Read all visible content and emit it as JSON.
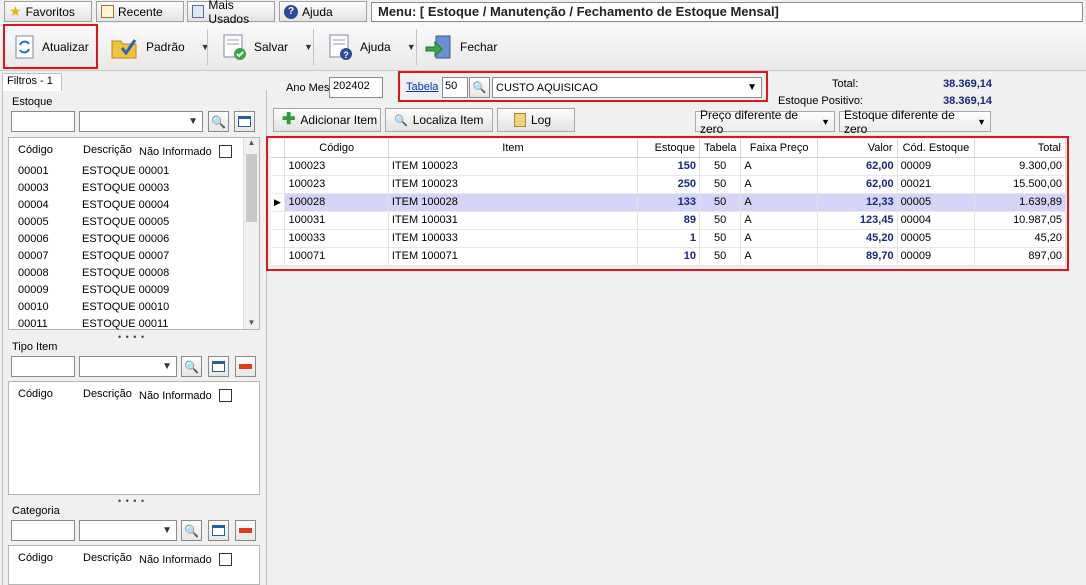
{
  "topbar": {
    "favoritos": "Favoritos",
    "recente": "Recente",
    "mais_usados": "Mais Usados",
    "ajuda": "Ajuda",
    "menu_path": "Menu: [ Estoque / Manutenção / Fechamento de Estoque Mensal]"
  },
  "toolbar": {
    "atualizar": "Atualizar",
    "padrao": "Padrão",
    "salvar": "Salvar",
    "ajuda": "Ajuda",
    "fechar": "Fechar"
  },
  "filters": {
    "tab": "Filtros - 1",
    "estoque": {
      "title": "Estoque",
      "col_codigo": "Código",
      "col_descricao": "Descrição",
      "nao_informado": "Não Informado",
      "items": [
        {
          "codigo": "00001",
          "descricao": "ESTOQUE 00001"
        },
        {
          "codigo": "00003",
          "descricao": "ESTOQUE 00003"
        },
        {
          "codigo": "00004",
          "descricao": "ESTOQUE 00004"
        },
        {
          "codigo": "00005",
          "descricao": "ESTOQUE 00005"
        },
        {
          "codigo": "00006",
          "descricao": "ESTOQUE 00006"
        },
        {
          "codigo": "00007",
          "descricao": "ESTOQUE 00007"
        },
        {
          "codigo": "00008",
          "descricao": "ESTOQUE 00008"
        },
        {
          "codigo": "00009",
          "descricao": "ESTOQUE 00009"
        },
        {
          "codigo": "00010",
          "descricao": "ESTOQUE 00010"
        },
        {
          "codigo": "00011",
          "descricao": "ESTOQUE 00011"
        }
      ]
    },
    "tipo_item": {
      "title": "Tipo Item",
      "col_codigo": "Código",
      "col_descricao": "Descrição",
      "nao_informado": "Não Informado"
    },
    "categoria": {
      "title": "Categoria",
      "col_codigo": "Código",
      "col_descricao": "Descrição",
      "nao_informado": "Não Informado"
    }
  },
  "header": {
    "ano_mes_label": "Ano Mes",
    "ano_mes_value": "202402",
    "tabela_link": "Tabela",
    "tabela_code": "50",
    "tabela_name": "CUSTO AQUISICAO",
    "total_label": "Total:",
    "total_value": "38.369,14",
    "estoque_positivo_label": "Estoque Positivo:",
    "estoque_positivo_value": "38.369,14"
  },
  "actions": {
    "adicionar": "Adicionar Item",
    "localiza": "Localiza Item",
    "log": "Log",
    "preco_filter": "Preço diferente de zero",
    "estoque_filter": "Estoque diferente de zero"
  },
  "grid": {
    "columns": [
      "Código",
      "Item",
      "Estoque",
      "Tabela",
      "Faixa Preço",
      "Valor",
      "Cód. Estoque",
      "Total"
    ],
    "rows": [
      {
        "codigo": "100023",
        "item": "ITEM 100023",
        "estoque": "150",
        "tabela": "50",
        "faixa": "A",
        "valor": "62,00",
        "cod_estoque": "00009",
        "total": "9.300,00"
      },
      {
        "codigo": "100023",
        "item": "ITEM 100023",
        "estoque": "250",
        "tabela": "50",
        "faixa": "A",
        "valor": "62,00",
        "cod_estoque": "00021",
        "total": "15.500,00"
      },
      {
        "codigo": "100028",
        "item": "ITEM 100028",
        "estoque": "133",
        "tabela": "50",
        "faixa": "A",
        "valor": "12,33",
        "cod_estoque": "00005",
        "total": "1.639,89"
      },
      {
        "codigo": "100031",
        "item": "ITEM 100031",
        "estoque": "89",
        "tabela": "50",
        "faixa": "A",
        "valor": "123,45",
        "cod_estoque": "00004",
        "total": "10.987,05"
      },
      {
        "codigo": "100033",
        "item": "ITEM 100033",
        "estoque": "1",
        "tabela": "50",
        "faixa": "A",
        "valor": "45,20",
        "cod_estoque": "00005",
        "total": "45,20"
      },
      {
        "codigo": "100071",
        "item": "ITEM 100071",
        "estoque": "10",
        "tabela": "50",
        "faixa": "A",
        "valor": "89,70",
        "cod_estoque": "00009",
        "total": "897,00"
      }
    ]
  },
  "colors": {
    "highlight": "#e0141e",
    "value_text": "#1a2880",
    "selected_row": "#d4d4f7"
  }
}
